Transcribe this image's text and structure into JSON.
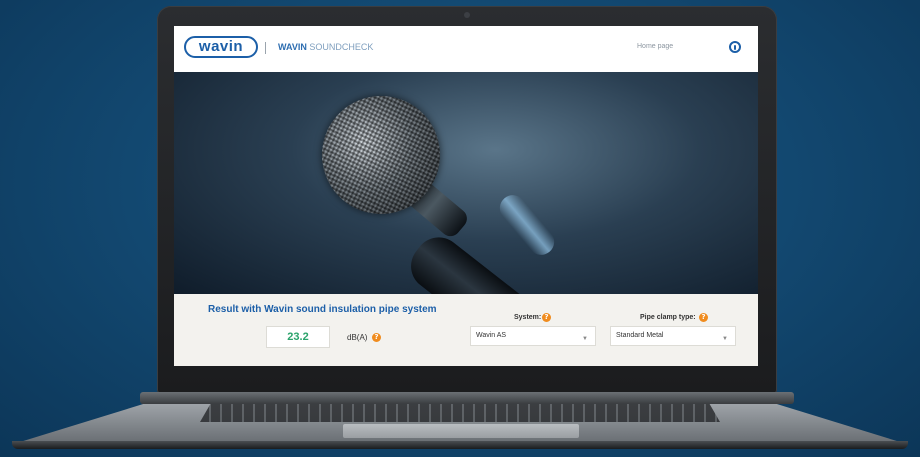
{
  "header": {
    "logo_text": "wavin",
    "app_title_bold": "WAVIN",
    "app_title_light": "SOUNDCHECK",
    "home_link": "Home page",
    "user_icon": "user-info-icon"
  },
  "hero": {
    "image": "microphone"
  },
  "result": {
    "title": "Result with Wavin sound insulation pipe system",
    "value": "23.2",
    "unit": "dB(A)",
    "value_color": "#2aa36b"
  },
  "system": {
    "label": "System:",
    "selected": "Wavin AS"
  },
  "pipe_clamp": {
    "label": "Pipe clamp type:",
    "selected": "Standard Metal"
  },
  "help_symbol": "?",
  "colors": {
    "brand_blue": "#1c5fa8",
    "help_orange": "#f08c1e"
  }
}
